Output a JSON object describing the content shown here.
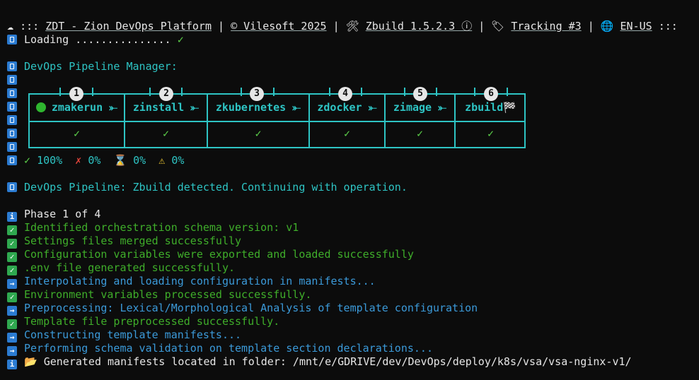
{
  "header": {
    "cloud_icon": "cloud-icon",
    "prefix": ":::",
    "app_name": "ZDT - Zion DevOps Platform",
    "copyright": "© Vilesoft 2025",
    "build": "Zbuild 1.5.2.3 ⓘ",
    "tracking": "Tracking #3",
    "locale": "EN-US",
    "suffix": ":::"
  },
  "loading": {
    "label": "Loading ...............",
    "status": "✓"
  },
  "pipeline_manager": {
    "title": "DevOps Pipeline Manager:",
    "steps": [
      {
        "num": "1",
        "name": "zmakerun ⤜"
      },
      {
        "num": "2",
        "name": "zinstall ⤜"
      },
      {
        "num": "3",
        "name": "zkubernetes ⤜"
      },
      {
        "num": "4",
        "name": "zdocker ⤜"
      },
      {
        "num": "5",
        "name": "zimage ⤜"
      },
      {
        "num": "6",
        "name": "zbuild🏁"
      }
    ],
    "check": "✓",
    "summary": {
      "success": "100%",
      "failed": "0%",
      "pending": "0%",
      "warning": "0%"
    }
  },
  "detected": "DevOps Pipeline: Zbuild detected. Continuing with operation.",
  "phase": "Phase 1 of 4",
  "log": [
    {
      "type": "check",
      "color": "green",
      "text": "Identified orchestration schema version: v1"
    },
    {
      "type": "check",
      "color": "green",
      "text": "Settings files merged successfully"
    },
    {
      "type": "check",
      "color": "green",
      "text": "Configuration variables were exported and loaded successfully"
    },
    {
      "type": "check",
      "color": "green",
      "text": ".env file generated successfully."
    },
    {
      "type": "arrow",
      "color": "blue",
      "text": "Interpolating and loading configuration in manifests..."
    },
    {
      "type": "check",
      "color": "green",
      "text": "Environment variables processed successfully."
    },
    {
      "type": "arrow",
      "color": "blue",
      "text": "Preprocessing: Lexical/Morphological Analysis of template configuration"
    },
    {
      "type": "check",
      "color": "green",
      "text": "Template file preprocessed successfully."
    },
    {
      "type": "arrow",
      "color": "blue",
      "text": "Constructing template manifests..."
    },
    {
      "type": "arrow",
      "color": "blue",
      "text": "Performing schema validation on template section declarations..."
    }
  ],
  "final": "Generated manifests located in folder: /mnt/e/GDRIVE/dev/DevOps/deploy/k8s/vsa/vsa-nginx-v1/"
}
